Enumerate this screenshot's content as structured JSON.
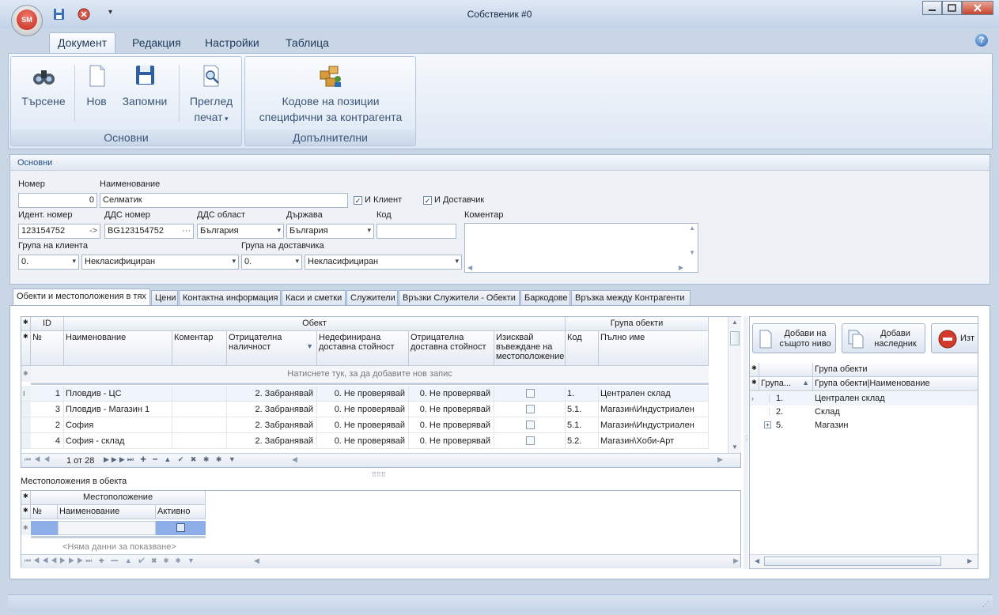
{
  "window": {
    "title": "Собственик #0"
  },
  "app_logo": "SM",
  "ribbon_tabs": [
    "Документ",
    "Редакция",
    "Настройки",
    "Таблица"
  ],
  "ribbon": {
    "main_group": {
      "label": "Основни",
      "buttons": [
        "Търсене",
        "Нов",
        "Запомни",
        "Преглед",
        "печат"
      ]
    },
    "extra_group": {
      "label": "Допълнителни",
      "button_line1": "Кодове на позиции",
      "button_line2": "специфични за контрагента"
    }
  },
  "main_panel": {
    "title": "Основни",
    "number_label": "Номер",
    "number_value": "0",
    "name_label": "Наименование",
    "name_value": "Селматик",
    "is_client_label": "И Клиент",
    "is_supplier_label": "И Доставчик",
    "ident_label": "Идент. номер",
    "ident_value": "123154752",
    "ident_arrow": "->",
    "vat_label": "ДДС номер",
    "vat_value": "BG123154752",
    "vat_dots": "···",
    "vat_area_label": "ДДС област",
    "vat_area_value": "България",
    "country_label": "Държава",
    "country_value": "България",
    "code_label": "Код",
    "code_value": "",
    "comment_label": "Коментар",
    "client_group_label": "Група на клиента",
    "client_group_code": "0.",
    "client_group_name": "Некласифициран",
    "supplier_group_label": "Група на доставчика",
    "supplier_group_code": "0.",
    "supplier_group_name": "Некласифициран"
  },
  "tabs": [
    "Обекти и местоположения в тях",
    "Цени",
    "Контактна информация",
    "Каси и сметки",
    "Служители",
    "Връзки Служители - Обекти",
    "Баркодове",
    "Връзка между Контрагенти"
  ],
  "objects_grid": {
    "band_id": "ID",
    "band_object": "Обект",
    "band_group": "Група обекти",
    "col_no": "№",
    "col_name": "Наименование",
    "col_comment": "Коментар",
    "col_neg1": "Отрицателна наличност",
    "col_undef": "Недефинирана доставна стойност",
    "col_neg2": "Отрицателна доставна стойност",
    "col_req": "Изисквай въвеждане на местоположение",
    "col_code": "Код",
    "col_fullname": "Пълно име",
    "new_row_hint": "Натиснете тук, за да добавите нов запис",
    "rows": [
      {
        "no": "1",
        "name": "Пловдив - ЦС",
        "neg1": "2. Забранявай",
        "undef": "0. Не проверявай",
        "neg2": "0. Не проверявай",
        "code": "1.",
        "full": "Централен склад"
      },
      {
        "no": "3",
        "name": "Пловдив - Магазин 1",
        "neg1": "2. Забранявай",
        "undef": "0. Не проверявай",
        "neg2": "0. Не проверявай",
        "code": "5.1.",
        "full": "Магазин\\Индустриален"
      },
      {
        "no": "2",
        "name": "София",
        "neg1": "2. Забранявай",
        "undef": "0. Не проверявай",
        "neg2": "0. Не проверявай",
        "code": "5.1.",
        "full": "Магазин\\Индустриален"
      },
      {
        "no": "4",
        "name": "София - склад",
        "neg1": "2. Забранявай",
        "undef": "0. Не проверявай",
        "neg2": "0. Не проверявай",
        "code": "5.2.",
        "full": "Магазин\\Хоби-Арт"
      }
    ],
    "pager": "1 от 28"
  },
  "locations": {
    "title": "Местоположения в обекта",
    "band": "Местоположение",
    "col_no": "№",
    "col_name": "Наименование",
    "col_active": "Активно",
    "empty_hint": "<Няма данни за показване>"
  },
  "right_panel": {
    "btn_same_level_1": "Добави на",
    "btn_same_level_2": "същото ниво",
    "btn_child_1": "Добави",
    "btn_child_2": "наследник",
    "btn_delete": "Изт",
    "band": "Група обекти",
    "col_group": "Група...",
    "col_name": "Група обекти|Наименование",
    "rows": [
      {
        "code": "1.",
        "name": "Централен склад"
      },
      {
        "code": "2.",
        "name": "Склад"
      },
      {
        "code": "5.",
        "name": "Магазин"
      }
    ]
  }
}
